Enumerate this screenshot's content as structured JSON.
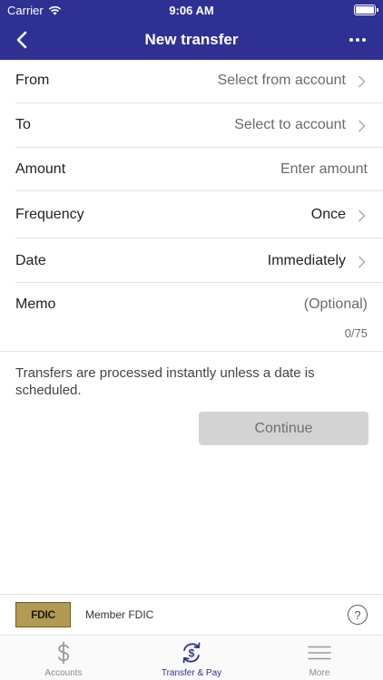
{
  "status_bar": {
    "carrier": "Carrier",
    "time": "9:06 AM",
    "battery_percent": 100
  },
  "nav": {
    "title": "New transfer"
  },
  "form": {
    "from": {
      "label": "From",
      "value": "Select from account"
    },
    "to": {
      "label": "To",
      "value": "Select to account"
    },
    "amount": {
      "label": "Amount",
      "placeholder": "Enter amount"
    },
    "frequency": {
      "label": "Frequency",
      "value": "Once"
    },
    "date": {
      "label": "Date",
      "value": "Immediately"
    },
    "memo": {
      "label": "Memo",
      "placeholder": "(Optional)",
      "count": "0/75"
    }
  },
  "note": "Transfers are processed instantly unless a date is scheduled.",
  "continue_label": "Continue",
  "fdic": {
    "logo_text": "FDIC",
    "label": "Member FDIC",
    "help_label": "?"
  },
  "tabs": [
    {
      "label": "Accounts",
      "icon": "dollar-icon"
    },
    {
      "label": "Transfer & Pay",
      "icon": "transfer-pay-icon"
    },
    {
      "label": "More",
      "icon": "menu-icon"
    }
  ],
  "colors": {
    "brand": "#2e3192",
    "disabled_button": "#d3d3d3",
    "fdic_gold": "#b39a52"
  }
}
